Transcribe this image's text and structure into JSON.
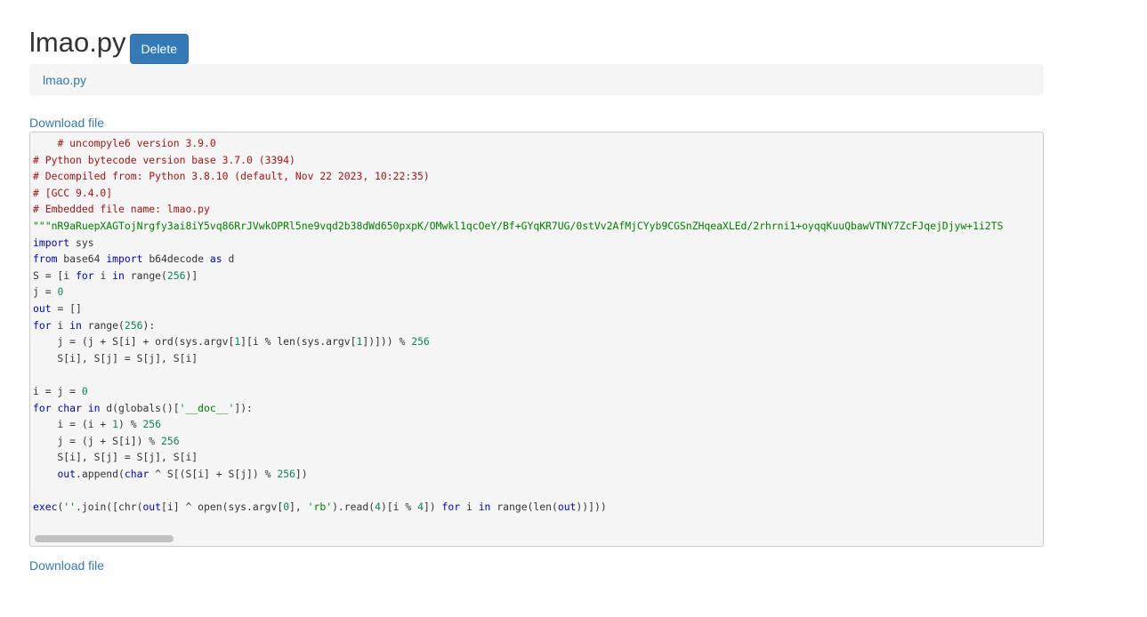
{
  "page": {
    "title": "lmao.py",
    "delete_label": "Delete",
    "breadcrumb_link": "lmao.py",
    "download_label": "Download file"
  },
  "code_lines": [
    {
      "segs": [
        {
          "t": "    ",
          "c": ""
        },
        {
          "t": "# uncompyle6 version 3.9.0",
          "c": "cm"
        }
      ]
    },
    {
      "segs": [
        {
          "t": "# Python bytecode version base 3.7.0 (3394)",
          "c": "cm"
        }
      ]
    },
    {
      "segs": [
        {
          "t": "# Decompiled from: Python 3.8.10 (default, Nov 22 2023, 10:22:35)",
          "c": "cm"
        }
      ]
    },
    {
      "segs": [
        {
          "t": "# [GCC 9.4.0]",
          "c": "cm"
        }
      ]
    },
    {
      "segs": [
        {
          "t": "# Embedded file name: lmao.py",
          "c": "cm"
        }
      ]
    },
    {
      "segs": [
        {
          "t": "\"\"\"nR9aRuepXAGTojNrgfy3ai8iY5vq86RrJVwkOPRl5ne9vqd2b38dWd650pxpK/OMwkl1qcOeY/Bf+GYqKR7UG/0stVv2AfMjCYyb9CGSnZHqeaXLEd/2rhrni1+oyqqKuuQbawVTNY7ZcFJqejDjyw+1i2TS",
          "c": "st"
        }
      ]
    },
    {
      "segs": [
        {
          "t": "import",
          "c": "kw"
        },
        {
          "t": " sys",
          "c": ""
        }
      ]
    },
    {
      "segs": [
        {
          "t": "from",
          "c": "kw"
        },
        {
          "t": " base64 ",
          "c": ""
        },
        {
          "t": "import",
          "c": "kw"
        },
        {
          "t": " b64decode ",
          "c": ""
        },
        {
          "t": "as",
          "c": "kw"
        },
        {
          "t": " d",
          "c": ""
        }
      ]
    },
    {
      "segs": [
        {
          "t": "S = [i ",
          "c": ""
        },
        {
          "t": "for",
          "c": "kw"
        },
        {
          "t": " i ",
          "c": ""
        },
        {
          "t": "in",
          "c": "kw"
        },
        {
          "t": " range(",
          "c": ""
        },
        {
          "t": "256",
          "c": "nu"
        },
        {
          "t": ")]",
          "c": ""
        }
      ]
    },
    {
      "segs": [
        {
          "t": "j = ",
          "c": ""
        },
        {
          "t": "0",
          "c": "nu"
        }
      ]
    },
    {
      "segs": [
        {
          "t": "out",
          "c": "kw"
        },
        {
          "t": " = []",
          "c": ""
        }
      ]
    },
    {
      "segs": [
        {
          "t": "for",
          "c": "kw"
        },
        {
          "t": " i ",
          "c": ""
        },
        {
          "t": "in",
          "c": "kw"
        },
        {
          "t": " range(",
          "c": ""
        },
        {
          "t": "256",
          "c": "nu"
        },
        {
          "t": "):",
          "c": ""
        }
      ]
    },
    {
      "segs": [
        {
          "t": "    j = (j + S[i] + ord(sys.argv[",
          "c": ""
        },
        {
          "t": "1",
          "c": "nu"
        },
        {
          "t": "][i % len(sys.argv[",
          "c": ""
        },
        {
          "t": "1",
          "c": "nu"
        },
        {
          "t": "])])) % ",
          "c": ""
        },
        {
          "t": "256",
          "c": "nu"
        }
      ]
    },
    {
      "segs": [
        {
          "t": "    S[i], S[j] = S[j], S[i]",
          "c": ""
        }
      ]
    },
    {
      "segs": [
        {
          "t": "",
          "c": ""
        }
      ]
    },
    {
      "segs": [
        {
          "t": "i = j = ",
          "c": ""
        },
        {
          "t": "0",
          "c": "nu"
        }
      ]
    },
    {
      "segs": [
        {
          "t": "for",
          "c": "kw"
        },
        {
          "t": " ",
          "c": ""
        },
        {
          "t": "char",
          "c": "kw"
        },
        {
          "t": " ",
          "c": ""
        },
        {
          "t": "in",
          "c": "kw"
        },
        {
          "t": " d(globals()[",
          "c": ""
        },
        {
          "t": "'__doc__'",
          "c": "st"
        },
        {
          "t": "]):",
          "c": ""
        }
      ]
    },
    {
      "segs": [
        {
          "t": "    i = (i + ",
          "c": ""
        },
        {
          "t": "1",
          "c": "nu"
        },
        {
          "t": ") % ",
          "c": ""
        },
        {
          "t": "256",
          "c": "nu"
        }
      ]
    },
    {
      "segs": [
        {
          "t": "    j = (j + S[i]) % ",
          "c": ""
        },
        {
          "t": "256",
          "c": "nu"
        }
      ]
    },
    {
      "segs": [
        {
          "t": "    S[i], S[j] = S[j], S[i]",
          "c": ""
        }
      ]
    },
    {
      "segs": [
        {
          "t": "    ",
          "c": ""
        },
        {
          "t": "out",
          "c": "kw"
        },
        {
          "t": ".append(",
          "c": ""
        },
        {
          "t": "char",
          "c": "kw"
        },
        {
          "t": " ^ S[(S[i] + S[j]) % ",
          "c": ""
        },
        {
          "t": "256",
          "c": "nu"
        },
        {
          "t": "])",
          "c": ""
        }
      ]
    },
    {
      "segs": [
        {
          "t": "",
          "c": ""
        }
      ]
    },
    {
      "segs": [
        {
          "t": "exec",
          "c": "kw"
        },
        {
          "t": "(",
          "c": ""
        },
        {
          "t": "''",
          "c": "st"
        },
        {
          "t": ".join([chr(",
          "c": ""
        },
        {
          "t": "out",
          "c": "kw"
        },
        {
          "t": "[i] ^ open(sys.argv[",
          "c": ""
        },
        {
          "t": "0",
          "c": "nu"
        },
        {
          "t": "], ",
          "c": ""
        },
        {
          "t": "'rb'",
          "c": "st"
        },
        {
          "t": ").read(",
          "c": ""
        },
        {
          "t": "4",
          "c": "nu"
        },
        {
          "t": ")[i % ",
          "c": ""
        },
        {
          "t": "4",
          "c": "nu"
        },
        {
          "t": "]) ",
          "c": ""
        },
        {
          "t": "for",
          "c": "kw"
        },
        {
          "t": " i ",
          "c": ""
        },
        {
          "t": "in",
          "c": "kw"
        },
        {
          "t": " range(len(",
          "c": ""
        },
        {
          "t": "out",
          "c": "kw"
        },
        {
          "t": "))]))",
          "c": ""
        }
      ]
    }
  ]
}
